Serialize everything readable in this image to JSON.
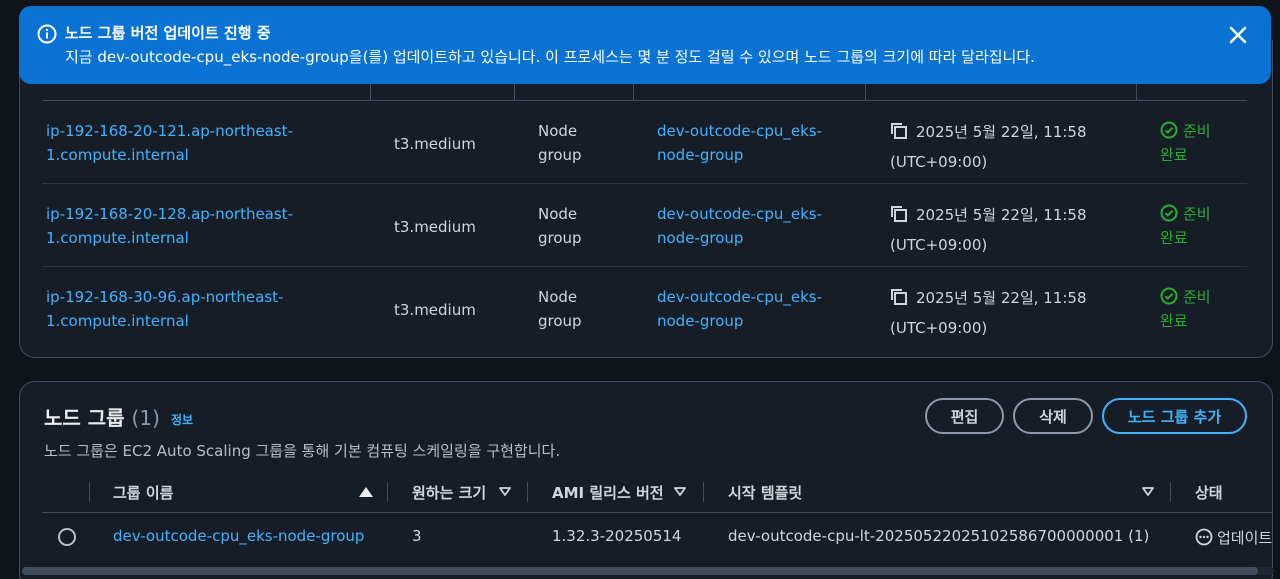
{
  "flash": {
    "title": "노드 그룹 버전 업데이트 진행 중",
    "message": "지금 dev-outcode-cpu_eks-node-group을(를) 업데이트하고 있습니다. 이 프로세스는 몇 분 정도 걸릴 수 있으며 노드 그룹의 크기에 따라 달라집니다.",
    "icon": "info-icon",
    "close_icon": "close-icon",
    "color": "#0972d3"
  },
  "nodes": {
    "rows": [
      {
        "name_line1": "ip-192-168-20-121.ap-northeast-",
        "name_line2": "1.compute.internal",
        "instance_type": "t3.medium",
        "type_line1": "Node",
        "type_line2": "group",
        "group_line1": "dev-outcode-cpu_eks-",
        "group_line2": "node-group",
        "created_line1": "2025년 5월 22일, 11:58",
        "created_line2": "(UTC+09:00)",
        "status_line1": "준비",
        "status_line2": "완료"
      },
      {
        "name_line1": "ip-192-168-20-128.ap-northeast-",
        "name_line2": "1.compute.internal",
        "instance_type": "t3.medium",
        "type_line1": "Node",
        "type_line2": "group",
        "group_line1": "dev-outcode-cpu_eks-",
        "group_line2": "node-group",
        "created_line1": "2025년 5월 22일, 11:58",
        "created_line2": "(UTC+09:00)",
        "status_line1": "준비",
        "status_line2": "완료"
      },
      {
        "name_line1": "ip-192-168-30-96.ap-northeast-",
        "name_line2": "1.compute.internal",
        "instance_type": "t3.medium",
        "type_line1": "Node",
        "type_line2": "group",
        "group_line1": "dev-outcode-cpu_eks-",
        "group_line2": "node-group",
        "created_line1": "2025년 5월 22일, 11:58",
        "created_line2": "(UTC+09:00)",
        "status_line1": "준비",
        "status_line2": "완료"
      }
    ]
  },
  "node_groups": {
    "title": "노드 그룹",
    "count": "(1)",
    "info": "정보",
    "description": "노드 그룹은 EC2 Auto Scaling 그룹을 통해 기본 컴퓨팅 스케일링을 구현합니다.",
    "edit_label": "편집",
    "delete_label": "삭제",
    "add_label": "노드 그룹 추가",
    "columns": {
      "name": "그룹 이름",
      "desired": "원하는 크기",
      "ami": "AMI 릴리스 버전",
      "template": "시작 템플릿",
      "status": "상태"
    },
    "row": {
      "name": "dev-outcode-cpu_eks-node-group",
      "desired": "3",
      "ami": "1.32.3-20250514",
      "template": "dev-outcode-cpu-lt-20250522025102586700000001 (1)",
      "status": "업데이트"
    }
  },
  "colors": {
    "link": "#42b4ff",
    "success": "#29ad32",
    "background": "#0f141a"
  }
}
